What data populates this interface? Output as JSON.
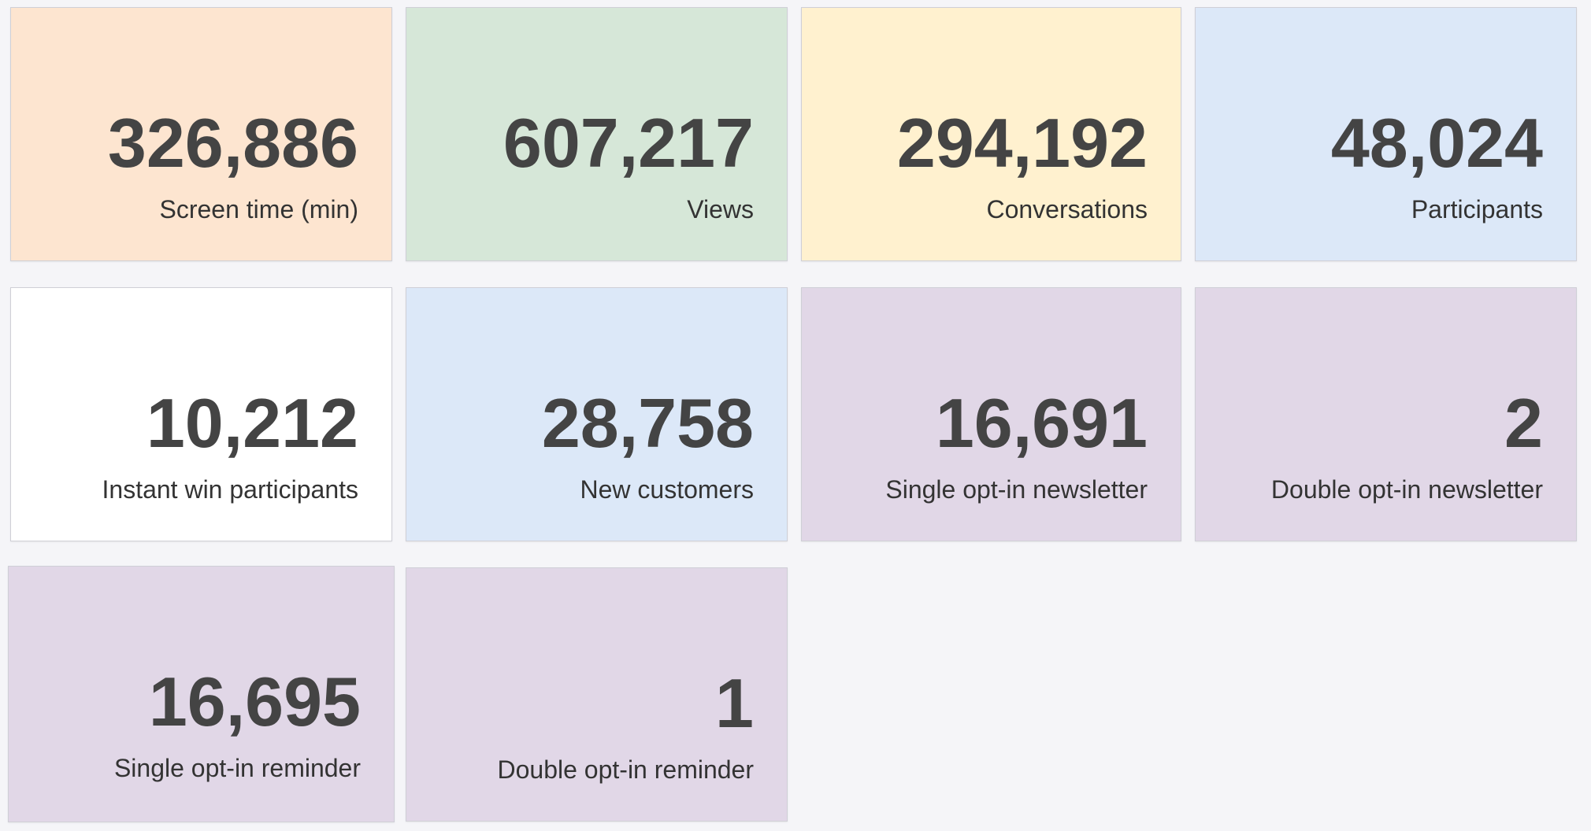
{
  "cards": [
    {
      "value": "326,886",
      "label": "Screen time (min)",
      "color": "#fde5d0"
    },
    {
      "value": "607,217",
      "label": "Views",
      "color": "#d6e7d8"
    },
    {
      "value": "294,192",
      "label": "Conversations",
      "color": "#fff1cf"
    },
    {
      "value": "48,024",
      "label": "Participants",
      "color": "#dce8f8"
    },
    {
      "value": "10,212",
      "label": "Instant win participants",
      "color": "#ffffff"
    },
    {
      "value": "28,758",
      "label": "New customers",
      "color": "#dce8f8"
    },
    {
      "value": "16,691",
      "label": "Single opt-in newsletter",
      "color": "#e1d7e7"
    },
    {
      "value": "2",
      "label": "Double opt-in newsletter",
      "color": "#e1d7e7"
    },
    {
      "value": "16,695",
      "label": "Single opt-in reminder",
      "color": "#e1d7e7"
    },
    {
      "value": "1",
      "label": "Double opt-in reminder",
      "color": "#e1d7e7"
    }
  ]
}
